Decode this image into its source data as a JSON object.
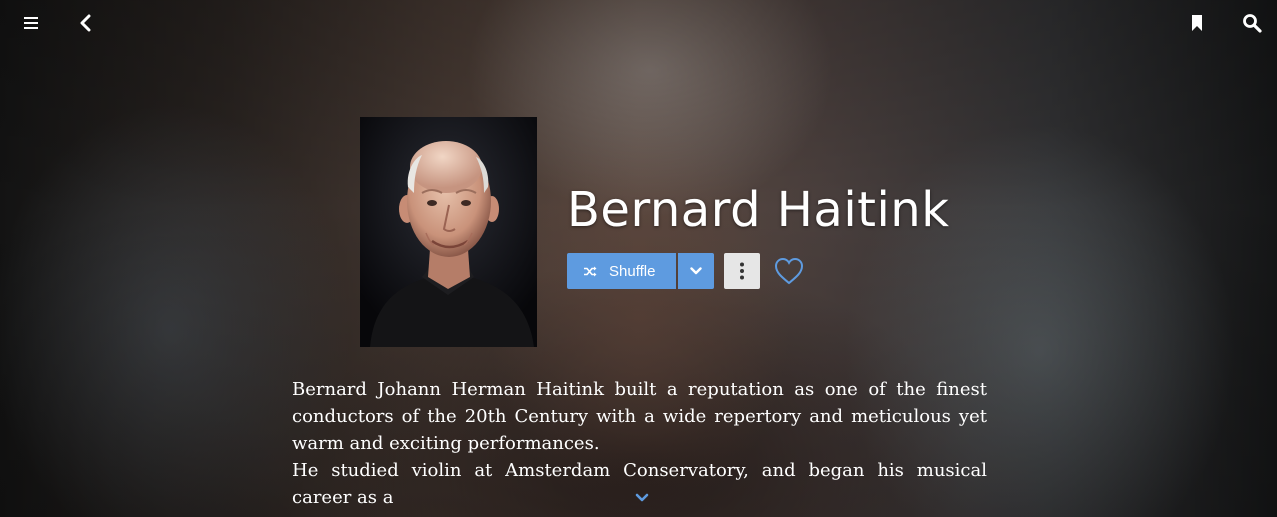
{
  "topbar": {
    "menu_icon": "hamburger-menu-icon",
    "back_icon": "chevron-left-icon",
    "bookmark_icon": "bookmark-icon",
    "search_icon": "search-icon"
  },
  "artist": {
    "name": "Bernard Haitink",
    "photo_icon": "artist-portrait"
  },
  "actions": {
    "shuffle_label": "Shuffle",
    "shuffle_icon": "shuffle-icon",
    "dropdown_icon": "chevron-down-icon",
    "more_icon": "vertical-dots-icon",
    "favorite_icon": "heart-outline-icon"
  },
  "bio": {
    "paragraphs": [
      "Bernard Johann Herman Haitink built a reputation as one of the finest conductors of the 20th Century with a wide repertory and meticulous yet warm and exciting performances.",
      "He studied violin at Amsterdam Conservatory, and began his musical career as a"
    ],
    "expand_icon": "chevron-down-icon"
  },
  "colors": {
    "accent": "#5e9be0",
    "text": "#ffffff",
    "secondary_button": "#e6e6e6"
  }
}
